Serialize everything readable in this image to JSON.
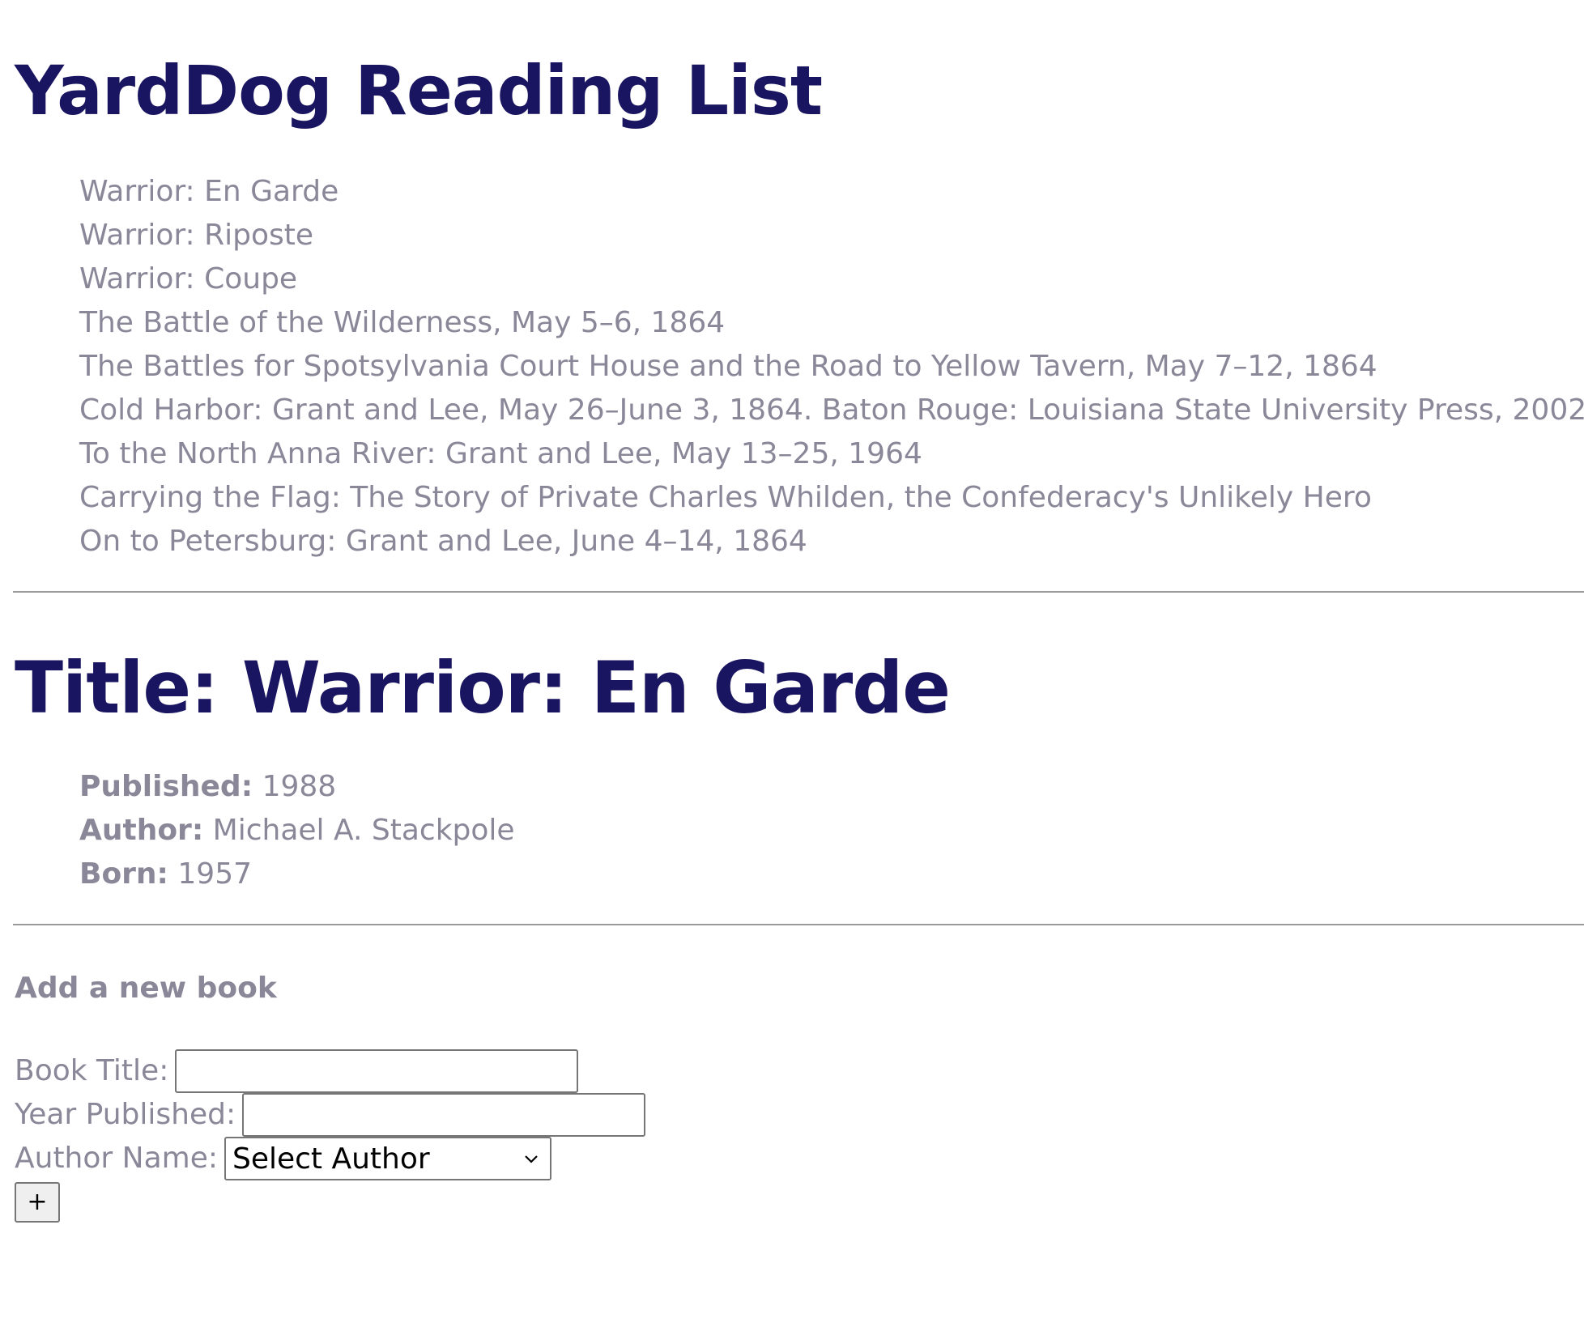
{
  "page": {
    "title": "YardDog Reading List"
  },
  "book_list": [
    "Warrior: En Garde",
    "Warrior: Riposte",
    "Warrior: Coupe",
    "The Battle of the Wilderness, May 5–6, 1864",
    "The Battles for Spotsylvania Court House and the Road to Yellow Tavern, May 7–12, 1864",
    "Cold Harbor: Grant and Lee, May 26–June 3, 1864. Baton Rouge: Louisiana State University Press, 2002",
    "To the North Anna River: Grant and Lee, May 13–25, 1964",
    "Carrying the Flag: The Story of Private Charles Whilden, the Confederacy's Unlikely Hero",
    "On to Petersburg: Grant and Lee, June 4–14, 1864"
  ],
  "selected_book": {
    "heading": "Title: Warrior: En Garde",
    "published_label": "Published:",
    "published_value": "1988",
    "author_label": "Author:",
    "author_value": "Michael A. Stackpole",
    "born_label": "Born:",
    "born_value": "1957"
  },
  "add_form": {
    "heading": "Add a new book",
    "book_title_label": "Book Title:",
    "book_title_value": "",
    "year_label": "Year Published:",
    "year_value": "",
    "author_label": "Author Name:",
    "author_selected": "Select Author",
    "submit_label": "+"
  },
  "colors": {
    "heading": "#1a1560",
    "body_text": "#8a8799",
    "rule": "#9a9a9a"
  }
}
